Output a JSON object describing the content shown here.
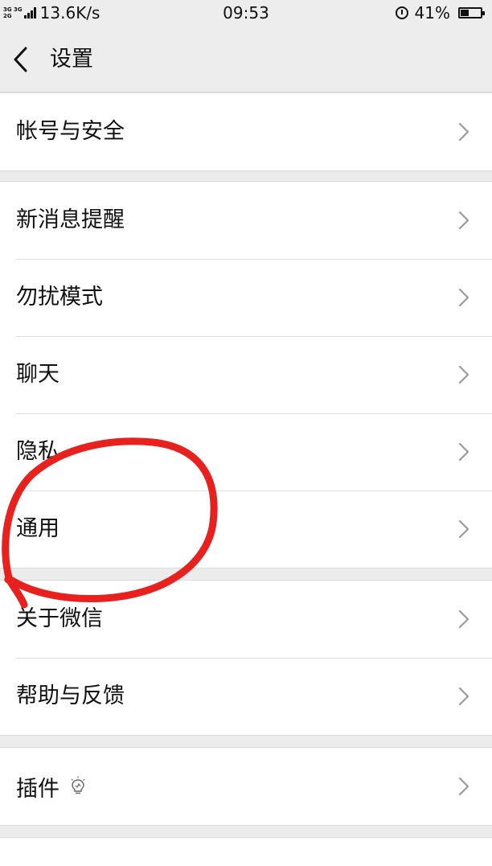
{
  "status_bar": {
    "network_top": "3G 3G",
    "network_bottom": "2G",
    "speed": "13.6K/s",
    "time": "09:53",
    "battery": "41%",
    "battery_fraction": 0.41
  },
  "nav": {
    "title": "设置"
  },
  "groups": [
    {
      "items": [
        {
          "label": "帐号与安全"
        }
      ]
    },
    {
      "items": [
        {
          "label": "新消息提醒"
        },
        {
          "label": "勿扰模式"
        },
        {
          "label": "聊天"
        },
        {
          "label": "隐私"
        },
        {
          "label": "通用"
        }
      ]
    },
    {
      "items": [
        {
          "label": "关于微信"
        },
        {
          "label": "帮助与反馈"
        }
      ]
    },
    {
      "items": [
        {
          "label": "插件",
          "icon": "lightbulb-icon"
        }
      ]
    }
  ],
  "colors": {
    "background": "#ececec",
    "row_background": "#ffffff",
    "annotation": "#e8201e"
  }
}
